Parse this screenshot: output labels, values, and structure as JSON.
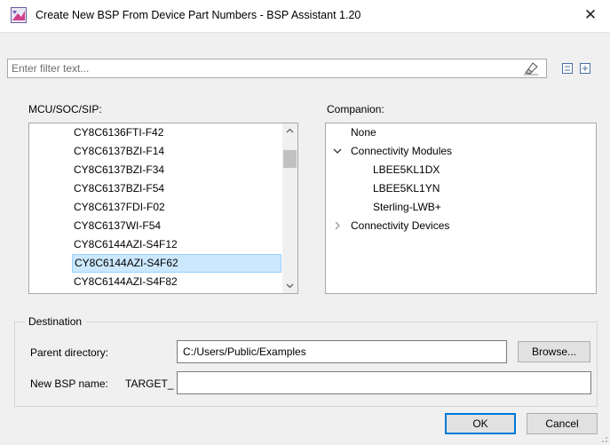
{
  "window": {
    "title": "Create New BSP From Device Part Numbers - BSP Assistant 1.20",
    "close_glyph": "✕"
  },
  "filter": {
    "placeholder": "Enter filter text..."
  },
  "mcu": {
    "label": "MCU/SOC/SIP:",
    "items": [
      "CY8C6136FTI-F42",
      "CY8C6137BZI-F14",
      "CY8C6137BZI-F34",
      "CY8C6137BZI-F54",
      "CY8C6137FDI-F02",
      "CY8C6137WI-F54",
      "CY8C6144AZI-S4F12",
      "CY8C6144AZI-S4F62",
      "CY8C6144AZI-S4F82"
    ],
    "selected": "CY8C6144AZI-S4F62"
  },
  "companion": {
    "label": "Companion:",
    "none": "None",
    "modules_group": "Connectivity Modules",
    "modules": [
      "LBEE5KL1DX",
      "LBEE5KL1YN",
      "Sterling-LWB+"
    ],
    "devices_group": "Connectivity Devices"
  },
  "destination": {
    "group_label": "Destination",
    "parent_label": "Parent directory:",
    "parent_value": "C:/Users/Public/Examples",
    "browse_label": "Browse...",
    "name_label": "New BSP name:",
    "name_prefix": "TARGET_",
    "name_value": ""
  },
  "buttons": {
    "ok": "OK",
    "cancel": "Cancel"
  },
  "colors": {
    "selection": "#cce8ff",
    "selection_border": "#99d1ff",
    "default_button_border": "#0078d7",
    "dialog_background": "#f0f0f0"
  },
  "icons": [
    "app-icon",
    "close-icon",
    "eraser-icon",
    "collapse-all-icon",
    "expand-all-icon",
    "chevron-up-icon",
    "chevron-down-icon",
    "chevron-expanded-icon",
    "chevron-collapsed-icon"
  ]
}
